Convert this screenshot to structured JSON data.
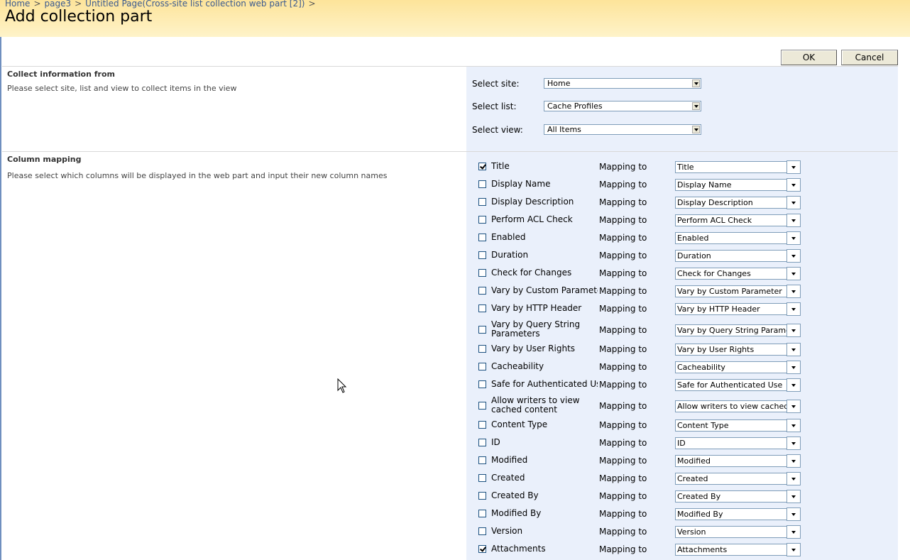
{
  "breadcrumb": {
    "items": [
      "Home",
      "page3",
      "Untitled Page(Cross-site list collection web part [2])"
    ],
    "separator": ">"
  },
  "page": {
    "title": "Add collection part"
  },
  "buttons": {
    "ok": "OK",
    "cancel": "Cancel"
  },
  "collect": {
    "title": "Collect information from",
    "description": "Please select site, list and view to collect items in the view",
    "site_label": "Select site:",
    "site_value": "Home",
    "list_label": "Select list:",
    "list_value": "Cache Profiles",
    "view_label": "Select view:",
    "view_value": "All Items"
  },
  "mapping": {
    "title": "Column mapping",
    "description": "Please select which columns will be displayed in the web part and input their new column names",
    "mapping_label": "Mapping to",
    "columns": [
      {
        "name": "Title",
        "checked": true,
        "value": "Title"
      },
      {
        "name": "Display Name",
        "checked": false,
        "value": "Display Name"
      },
      {
        "name": "Display Description",
        "checked": false,
        "value": "Display Description"
      },
      {
        "name": "Perform ACL Check",
        "checked": false,
        "value": "Perform ACL Check"
      },
      {
        "name": "Enabled",
        "checked": false,
        "value": "Enabled"
      },
      {
        "name": "Duration",
        "checked": false,
        "value": "Duration"
      },
      {
        "name": "Check for Changes",
        "checked": false,
        "value": "Check for Changes"
      },
      {
        "name": "Vary by Custom Parameter",
        "checked": false,
        "value": "Vary by Custom Parameter"
      },
      {
        "name": "Vary by HTTP Header",
        "checked": false,
        "value": "Vary by HTTP Header"
      },
      {
        "name": "Vary by Query String Parameters",
        "checked": false,
        "value": "Vary by Query String Parameters"
      },
      {
        "name": "Vary by User Rights",
        "checked": false,
        "value": "Vary by User Rights"
      },
      {
        "name": "Cacheability",
        "checked": false,
        "value": "Cacheability"
      },
      {
        "name": "Safe for Authenticated Use",
        "checked": false,
        "value": "Safe for Authenticated Use"
      },
      {
        "name": "Allow writers to view cached content",
        "checked": false,
        "value": "Allow writers to view cached content"
      },
      {
        "name": "Content Type",
        "checked": false,
        "value": "Content Type"
      },
      {
        "name": "ID",
        "checked": false,
        "value": "ID"
      },
      {
        "name": "Modified",
        "checked": false,
        "value": "Modified"
      },
      {
        "name": "Created",
        "checked": false,
        "value": "Created"
      },
      {
        "name": "Created By",
        "checked": false,
        "value": "Created By"
      },
      {
        "name": "Modified By",
        "checked": false,
        "value": "Modified By"
      },
      {
        "name": "Version",
        "checked": false,
        "value": "Version"
      },
      {
        "name": "Attachments",
        "checked": true,
        "value": "Attachments"
      }
    ]
  },
  "colors": {
    "title_bar_top": "#fde49a",
    "panel_bg": "#eaf0fb",
    "link": "#3b5a8f"
  }
}
